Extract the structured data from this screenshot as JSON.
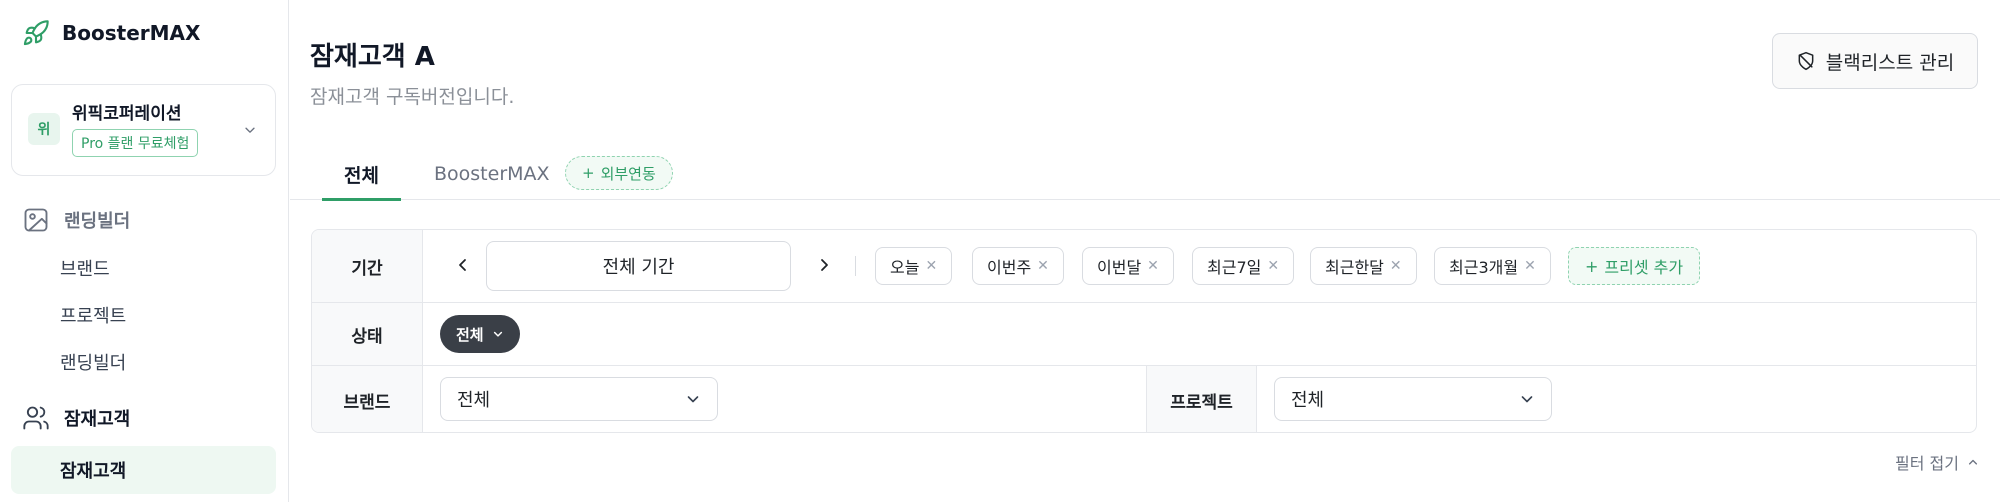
{
  "app": {
    "name": "BoosterMAX",
    "accent": "#2f9e67"
  },
  "org": {
    "avatar": "위",
    "name": "위픽코퍼레이션",
    "plan": "Pro 플랜 무료체험"
  },
  "sidebar": {
    "sections": [
      {
        "label": "랜딩빌더",
        "icon": "image-icon",
        "items": [
          "브랜드",
          "프로젝트",
          "랜딩빌더"
        ]
      },
      {
        "label": "잠재고객",
        "icon": "users-icon",
        "items": [
          "잠재고객"
        ]
      }
    ],
    "active_item": "잠재고객"
  },
  "header": {
    "title": "잠재고객 A",
    "subtitle": "잠재고객 구독버전입니다.",
    "blacklist_button": "블랙리스트 관리"
  },
  "tabs": {
    "items": [
      {
        "label": "전체",
        "active": true
      },
      {
        "label": "BoosterMAX",
        "active": false
      }
    ],
    "external": "외부연동"
  },
  "filters": {
    "period": {
      "label": "기간",
      "value": "전체 기간",
      "presets": [
        "오늘",
        "이번주",
        "이번달",
        "최근7일",
        "최근한달",
        "최근3개월"
      ],
      "add_preset": "프리셋 추가"
    },
    "status": {
      "label": "상태",
      "value": "전체"
    },
    "brand": {
      "label": "브랜드",
      "value": "전체"
    },
    "project": {
      "label": "프로젝트",
      "value": "전체"
    },
    "collapse": "필터 접기"
  }
}
